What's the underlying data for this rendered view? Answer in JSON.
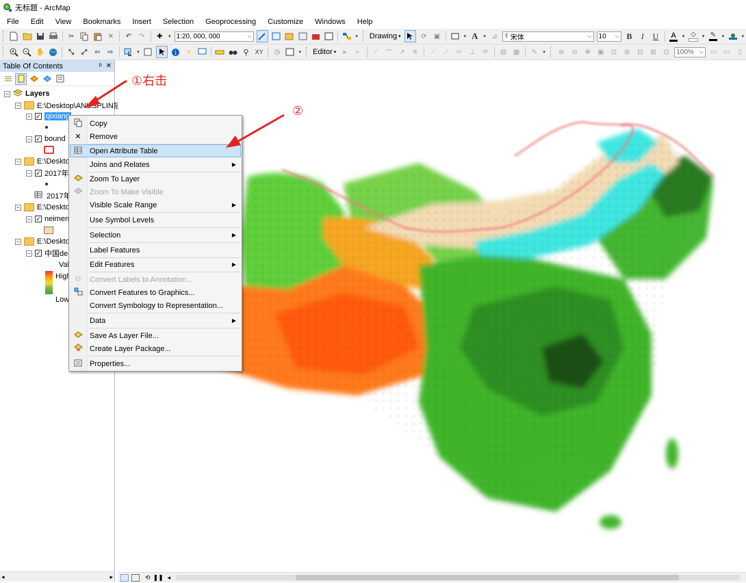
{
  "window": {
    "title": "无标题 - ArcMap"
  },
  "menubar": [
    "File",
    "Edit",
    "View",
    "Bookmarks",
    "Insert",
    "Selection",
    "Geoprocessing",
    "Customize",
    "Windows",
    "Help"
  ],
  "toolbar": {
    "scale_value": "1:20, 000, 000",
    "drawing_label": "Drawing",
    "font_name": "宋体",
    "font_size": "10",
    "bold": "B",
    "italic": "I",
    "underline": "U",
    "editor_label": "Editor",
    "zoom_percent": "100%"
  },
  "toc": {
    "title": "Table Of Contents",
    "pin": "ᵖ",
    "close": "✕",
    "root": "Layers",
    "rows": [
      {
        "kind": "folder",
        "label": "E:\\Desktop\\ANUSPLIN插"
      },
      {
        "kind": "layer",
        "label": "qixiang",
        "selected": true
      },
      {
        "kind": "layer",
        "label": "bound"
      },
      {
        "kind": "folder",
        "label": "E:\\Deskto"
      },
      {
        "kind": "layer",
        "label": "2017年"
      },
      {
        "kind": "table",
        "label": "2017年"
      },
      {
        "kind": "folder",
        "label": "E:\\Deskto"
      },
      {
        "kind": "layer",
        "label": "neimen"
      },
      {
        "kind": "folder",
        "label": "E:\\Deskto"
      },
      {
        "kind": "layer",
        "label": "中国de"
      }
    ],
    "legend_value": "Val",
    "legend_high": "High",
    "legend_low": "Low"
  },
  "context_menu": [
    {
      "label": "Copy",
      "icon": "copy-icon",
      "enabled": true
    },
    {
      "label": "Remove",
      "icon": "remove-icon",
      "enabled": true
    },
    {
      "label": "Open Attribute Table",
      "icon": "table-icon",
      "enabled": true,
      "highlighted": true
    },
    {
      "label": "Joins and Relates",
      "enabled": true,
      "submenu": true
    },
    {
      "label": "Zoom To Layer",
      "icon": "zoom-layer-icon",
      "enabled": true
    },
    {
      "label": "Zoom To Make Visible",
      "icon": "zoom-visible-icon",
      "enabled": false
    },
    {
      "label": "Visible Scale Range",
      "enabled": true,
      "submenu": true
    },
    {
      "label": "Use Symbol Levels",
      "enabled": true
    },
    {
      "label": "Selection",
      "enabled": true,
      "submenu": true
    },
    {
      "label": "Label Features",
      "enabled": true
    },
    {
      "label": "Edit Features",
      "enabled": true,
      "submenu": true
    },
    {
      "label": "Convert Labels to Annotation...",
      "icon": "annotation-icon",
      "enabled": false
    },
    {
      "label": "Convert Features to Graphics...",
      "icon": "graphics-icon",
      "enabled": true
    },
    {
      "label": "Convert Symbology to Representation...",
      "enabled": true
    },
    {
      "label": "Data",
      "enabled": true,
      "submenu": true
    },
    {
      "label": "Save As Layer File...",
      "icon": "layer-file-icon",
      "enabled": true
    },
    {
      "label": "Create Layer Package...",
      "icon": "layer-package-icon",
      "enabled": true
    },
    {
      "label": "Properties...",
      "icon": "properties-icon",
      "enabled": true
    }
  ],
  "annotations": {
    "step1": "①右击",
    "step2": "②"
  },
  "colors": {
    "highlight": "#cce4f7",
    "selection": "#3399ff",
    "annotation": "#e42424"
  }
}
